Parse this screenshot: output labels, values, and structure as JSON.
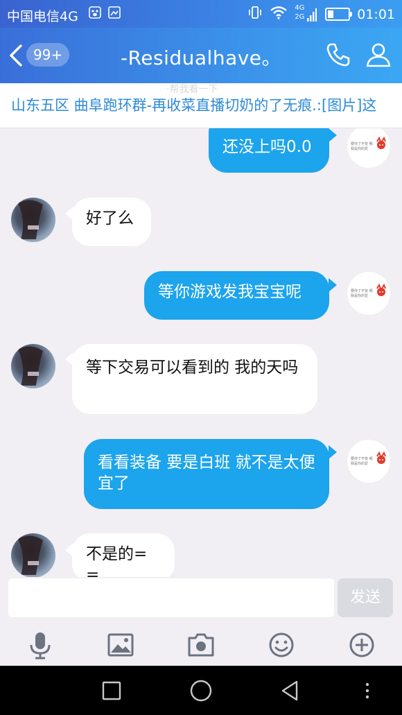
{
  "status_bar": {
    "carrier": "中国电信4G",
    "network_small": "4G",
    "network_small2": "2G",
    "battery_level": 0.3,
    "time": "01:01"
  },
  "header": {
    "back_icon": "chevron-left-icon",
    "unread_badge": "99+",
    "title": "-Residualhave。",
    "call_icon": "phone-icon",
    "profile_icon": "person-icon"
  },
  "notice": {
    "text": "山东五区  曲阜跑环群-再收菜直播切奶的了无痕.:[图片]这",
    "ghost": "·帮我看一下"
  },
  "messages": [
    {
      "side": "me",
      "text": "还没上吗0.0"
    },
    {
      "side": "other",
      "text": "好了么"
    },
    {
      "side": "me",
      "text": "等你游戏发我宝宝呢"
    },
    {
      "side": "other",
      "text": "等下交易可以看到的 我的天吗"
    },
    {
      "side": "me",
      "text": "看看装备 要是白班 就不是太便宜了"
    },
    {
      "side": "other",
      "text": "不是的= ="
    }
  ],
  "input": {
    "value": "",
    "send_label": "发送"
  },
  "toolbar": {
    "items": [
      "microphone-icon",
      "image-icon",
      "camera-icon",
      "emoji-icon",
      "plus-icon"
    ]
  },
  "nav": {
    "items": [
      "recents-icon",
      "home-icon",
      "back-icon",
      "menu-dots-icon"
    ]
  },
  "colors": {
    "accent": "#1ca4ec",
    "header": "#3b93ea",
    "notice_text": "#2d8ad8",
    "background": "#f1eef4"
  }
}
